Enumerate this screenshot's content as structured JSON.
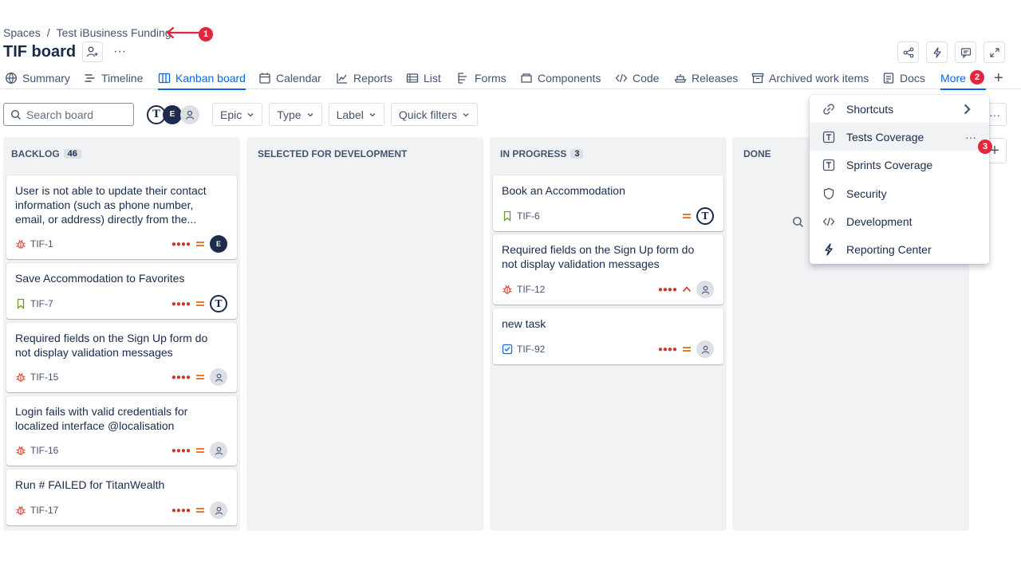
{
  "breadcrumb": {
    "root": "Spaces",
    "separator": "/",
    "project": "Test iBusiness Funding"
  },
  "page": {
    "title": "TIF board"
  },
  "annotations": [
    "1",
    "2",
    "3"
  ],
  "tabs": [
    {
      "label": "Summary",
      "icon": "globe-icon"
    },
    {
      "label": "Timeline",
      "icon": "timeline-icon"
    },
    {
      "label": "Kanban board",
      "icon": "board-icon",
      "active": true
    },
    {
      "label": "Calendar",
      "icon": "calendar-icon"
    },
    {
      "label": "Reports",
      "icon": "chart-icon"
    },
    {
      "label": "List",
      "icon": "list-icon"
    },
    {
      "label": "Forms",
      "icon": "forms-icon"
    },
    {
      "label": "Components",
      "icon": "components-icon"
    },
    {
      "label": "Code",
      "icon": "code-icon"
    },
    {
      "label": "Releases",
      "icon": "ship-icon"
    },
    {
      "label": "Archived work items",
      "icon": "archive-icon"
    },
    {
      "label": "Docs",
      "icon": "doc-icon"
    },
    {
      "label": "More",
      "icon": "none"
    }
  ],
  "toolbar": {
    "search_placeholder": "Search board",
    "filters": [
      "Epic",
      "Type",
      "Label",
      "Quick filters"
    ],
    "avatar_letter_e": "E",
    "avatar_letter_t": "T"
  },
  "columns": [
    {
      "title": "BACKLOG",
      "count": "46",
      "cards": [
        {
          "title": "User is not able to update their contact information (such as phone number, email, or address) directly from the...",
          "key": "TIF-1",
          "type": "bug",
          "priority": "medium",
          "assignee": "E"
        },
        {
          "title": "Save Accommodation to Favorites",
          "key": "TIF-7",
          "type": "story",
          "priority": "medium",
          "assignee": "T"
        },
        {
          "title": "Required fields on the Sign Up form do not display validation messages",
          "key": "TIF-15",
          "type": "bug",
          "priority": "medium",
          "assignee": "unassigned"
        },
        {
          "title": "Login fails with valid credentials for localized interface @localisation",
          "key": "TIF-16",
          "type": "bug",
          "priority": "medium",
          "assignee": "unassigned"
        },
        {
          "title": "Run # FAILED for TitanWealth",
          "key": "TIF-17",
          "type": "bug",
          "priority": "medium",
          "assignee": "unassigned"
        }
      ]
    },
    {
      "title": "SELECTED FOR DEVELOPMENT",
      "count": "",
      "cards": []
    },
    {
      "title": "IN PROGRESS",
      "count": "3",
      "cards": [
        {
          "title": "Book an Accommodation",
          "key": "TIF-6",
          "type": "story",
          "priority": "medium",
          "assignee": "T"
        },
        {
          "title": "Required fields on the Sign Up form do not display validation messages",
          "key": "TIF-12",
          "type": "bug",
          "priority": "high",
          "assignee": "unassigned"
        },
        {
          "title": "new task",
          "key": "TIF-92",
          "type": "task",
          "priority": "medium",
          "assignee": "unassigned"
        }
      ]
    },
    {
      "title": "DONE",
      "count": "",
      "cards": []
    }
  ],
  "more_menu": [
    {
      "label": "Shortcuts",
      "icon": "link-icon",
      "chevron": true
    },
    {
      "label": "Tests Coverage",
      "icon": "tests-app-icon",
      "hover": true
    },
    {
      "label": "Sprints Coverage",
      "icon": "tests-app-icon"
    },
    {
      "label": "Security",
      "icon": "shield-icon"
    },
    {
      "label": "Development",
      "icon": "code-icon"
    },
    {
      "label": "Reporting Center",
      "icon": "bolt-icon"
    }
  ],
  "colors": {
    "accent": "#0c66e4",
    "annotation": "#e2263d",
    "bug": "#e34935",
    "story": "#6a9a23",
    "task": "#1868db",
    "priority_medium": "#e56910",
    "priority_high": "#c9372c"
  }
}
